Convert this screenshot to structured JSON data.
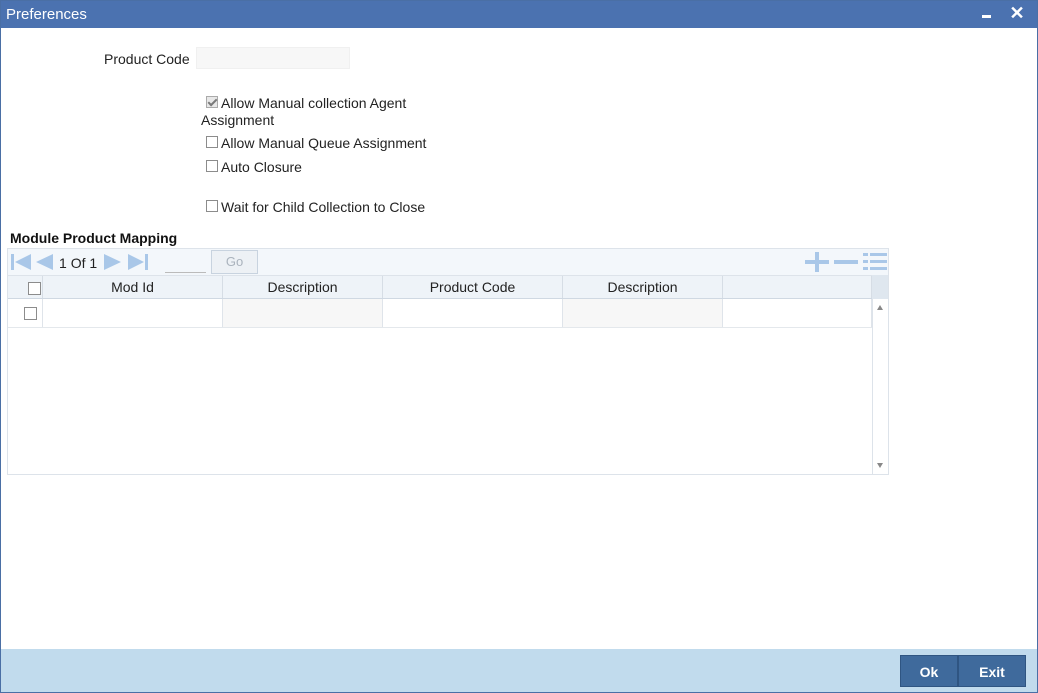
{
  "window": {
    "title": "Preferences",
    "minimize_glyph": "−",
    "close_glyph": "✕"
  },
  "form": {
    "product_code_label": "Product Code",
    "product_code_value": "",
    "checkboxes": [
      {
        "label_line1": "Allow Manual collection Agent",
        "label_line2": "Assignment",
        "checked": true
      },
      {
        "label": "Allow Manual Queue Assignment",
        "checked": false
      },
      {
        "label": "Auto Closure",
        "checked": false
      },
      {
        "label": "Wait for Child Collection to Close",
        "checked": false
      }
    ]
  },
  "grid": {
    "section_title": "Module Product Mapping",
    "pagination": {
      "current": "1",
      "of_label": "Of",
      "total": "1",
      "goto_value": "",
      "go_label": "Go"
    },
    "columns": [
      "Mod Id",
      "Description",
      "Product Code",
      "Description"
    ],
    "rows": [
      {
        "mod_id": "",
        "description": "",
        "product_code": "",
        "product_description": ""
      }
    ],
    "icons": [
      "first-page-icon",
      "prev-page-icon",
      "next-page-icon",
      "last-page-icon",
      "add-row-icon",
      "delete-row-icon",
      "single-view-icon"
    ],
    "accent_color": "#a9c7e8"
  },
  "footer": {
    "ok_label": "Ok",
    "exit_label": "Exit"
  },
  "colors": {
    "title_bar": "#4b72b0",
    "footer": "#c1dbed",
    "button": "#3f6a9c"
  }
}
